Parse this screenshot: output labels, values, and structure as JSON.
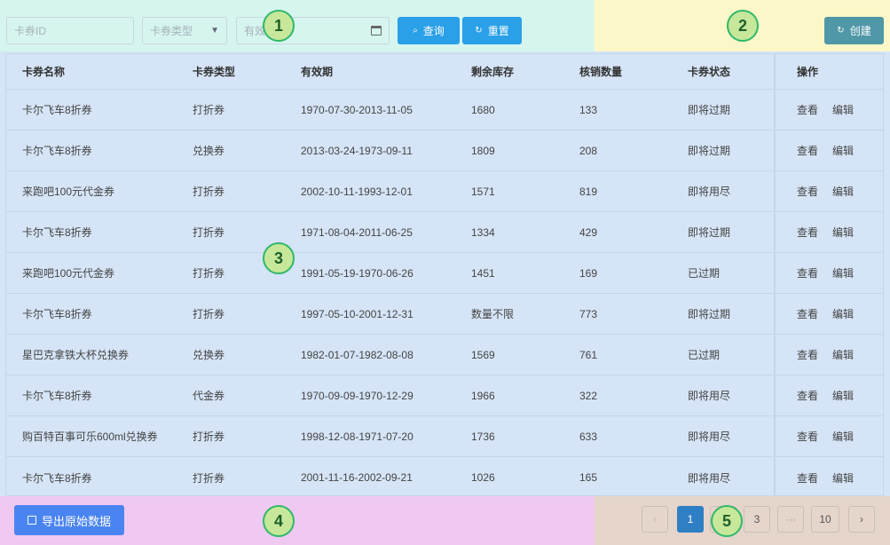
{
  "filter": {
    "card_id_placeholder": "卡券ID",
    "card_type_placeholder": "卡券类型",
    "validity_placeholder": "有效期",
    "search_label": "查询",
    "reset_label": "重置"
  },
  "header": {
    "create_label": "创建"
  },
  "table": {
    "columns": [
      "卡券名称",
      "卡券类型",
      "有效期",
      "剩余库存",
      "核销数量",
      "卡券状态",
      "操作"
    ],
    "view_label": "查看",
    "edit_label": "编辑",
    "rows": [
      [
        "卡尔飞车8折券",
        "打折券",
        "1970-07-30-2013-11-05",
        "1680",
        "133",
        "即将过期"
      ],
      [
        "卡尔飞车8折券",
        "兑换券",
        "2013-03-24-1973-09-11",
        "1809",
        "208",
        "即将过期"
      ],
      [
        "来跑吧100元代金券",
        "打折券",
        "2002-10-11-1993-12-01",
        "1571",
        "819",
        "即将用尽"
      ],
      [
        "卡尔飞车8折券",
        "打折券",
        "1971-08-04-2011-06-25",
        "1334",
        "429",
        "即将过期"
      ],
      [
        "来跑吧100元代金券",
        "打折券",
        "1991-05-19-1970-06-26",
        "1451",
        "169",
        "已过期"
      ],
      [
        "卡尔飞车8折券",
        "打折券",
        "1997-05-10-2001-12-31",
        "数量不限",
        "773",
        "即将过期"
      ],
      [
        "星巴克拿铁大杯兑换券",
        "兑换券",
        "1982-01-07-1982-08-08",
        "1569",
        "761",
        "已过期"
      ],
      [
        "卡尔飞车8折券",
        "代金券",
        "1970-09-09-1970-12-29",
        "1966",
        "322",
        "即将用尽"
      ],
      [
        "购百特百事可乐600ml兑换券",
        "打折券",
        "1998-12-08-1971-07-20",
        "1736",
        "633",
        "即将用尽"
      ],
      [
        "卡尔飞车8折券",
        "打折券",
        "2001-11-16-2002-09-21",
        "1026",
        "165",
        "即将用尽"
      ]
    ]
  },
  "footer": {
    "export_label": "导出原始数据",
    "pagination": {
      "prev": "‹",
      "next": "›",
      "pages": [
        "1",
        "2",
        "3",
        "···",
        "10"
      ],
      "current": "1"
    }
  },
  "markers": [
    "1",
    "2",
    "3",
    "4",
    "5"
  ],
  "colors": {
    "primary": "#2aa0e8",
    "export": "#4a84f0",
    "active_page": "#2f7fc4"
  }
}
